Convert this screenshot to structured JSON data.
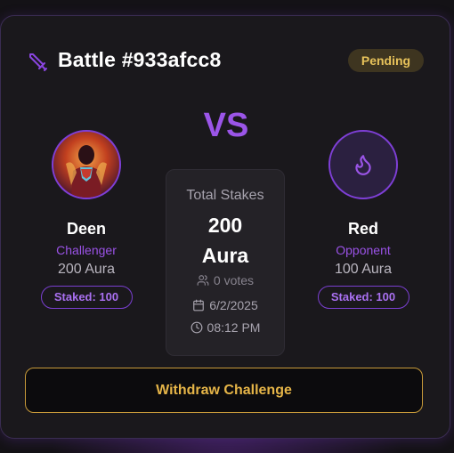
{
  "battle": {
    "title": "Battle #933afcc8",
    "status": "Pending",
    "vs_label": "VS"
  },
  "challenger": {
    "name": "Deen",
    "role": "Challenger",
    "aura": "200 Aura",
    "staked": "Staked: 100"
  },
  "opponent": {
    "name": "Red",
    "role": "Opponent",
    "aura": "100 Aura",
    "staked": "Staked: 100",
    "avatar_icon": "flame-icon"
  },
  "stakes": {
    "label": "Total Stakes",
    "amount_line1": "200",
    "amount_line2": "Aura",
    "votes": "0 votes",
    "date": "6/2/2025",
    "time": "08:12 PM"
  },
  "actions": {
    "withdraw_label": "Withdraw Challenge"
  },
  "colors": {
    "accent_purple": "#9b55e8",
    "pending_gold": "#e7c25a",
    "withdraw_gold": "#e6b548",
    "card_bg": "#1a181c"
  }
}
